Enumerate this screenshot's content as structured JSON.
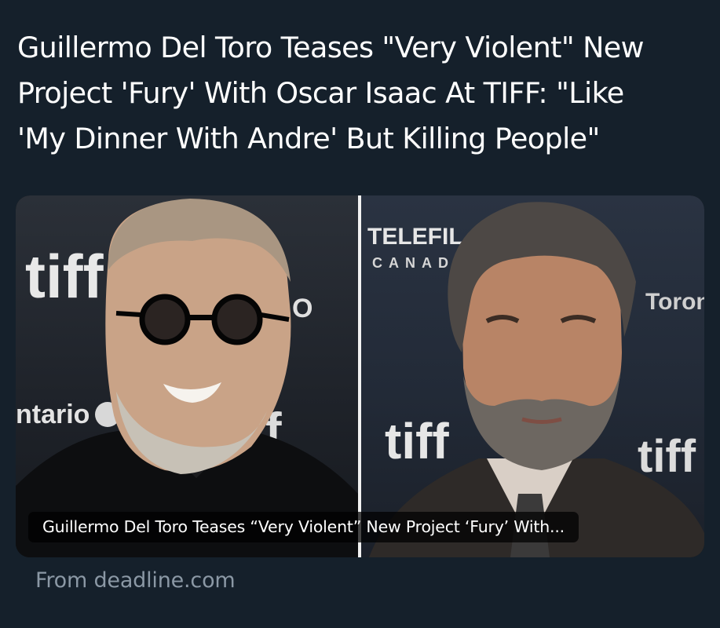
{
  "post": {
    "text_lines": [
      "Guillermo Del Toro Teases \"Very Violent\" New",
      "Project 'Fury' With Oscar Isaac At TIFF: \"Like",
      "'My Dinner With Andre' But Killing People\""
    ]
  },
  "link_card": {
    "caption": "Guillermo Del Toro Teases “Very Violent” New Project ‘Fury’ With...",
    "source": "From deadline.com",
    "left_image": {
      "backdrop_text": [
        "tiff",
        "ntario",
        "O",
        "f"
      ]
    },
    "right_image": {
      "backdrop_text": [
        "TELEFIL",
        "CANAD",
        "tiff",
        "tiff",
        "Toron"
      ]
    }
  },
  "colors": {
    "background": "#15202b",
    "text": "#ffffff",
    "secondary_text": "#8b98a5",
    "caption_bg": "rgba(0,0,0,0.72)"
  }
}
